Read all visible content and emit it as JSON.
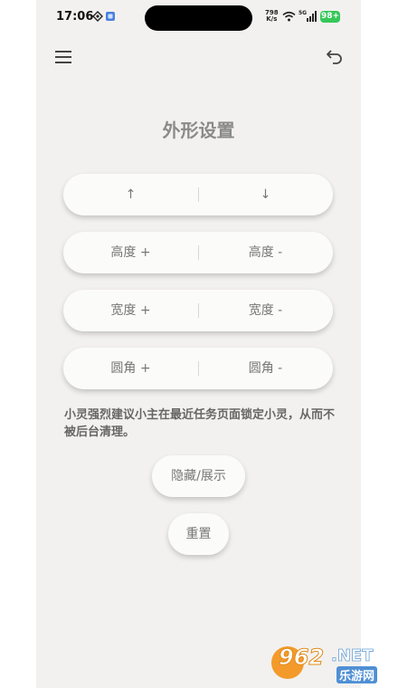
{
  "status_bar": {
    "time": "17:06",
    "net_speed_value": "798",
    "net_speed_unit": "K/s",
    "signal_label": "5G",
    "battery": "98+"
  },
  "app_bar": {
    "menu_icon": "hamburger-menu-icon",
    "back_icon": "undo-back-icon"
  },
  "title": "外形设置",
  "controls": [
    {
      "left": "↑",
      "right": "↓"
    },
    {
      "left": "高度 +",
      "right": "高度 -"
    },
    {
      "left": "宽度 +",
      "right": "宽度 -"
    },
    {
      "left": "圆角 +",
      "right": "圆角 -"
    }
  ],
  "notice": "小灵强烈建议小主在最近任务页面锁定小灵，从而不被后台清理。",
  "buttons": {
    "toggle": "隐藏/展示",
    "reset": "重置"
  },
  "watermark": {
    "brand": "962",
    "suffix": ".NET",
    "subtitle": "乐游网"
  },
  "colors": {
    "background": "#f2f1ef",
    "button": "#fbfbfa",
    "text": "#777777",
    "battery": "#35c759"
  }
}
